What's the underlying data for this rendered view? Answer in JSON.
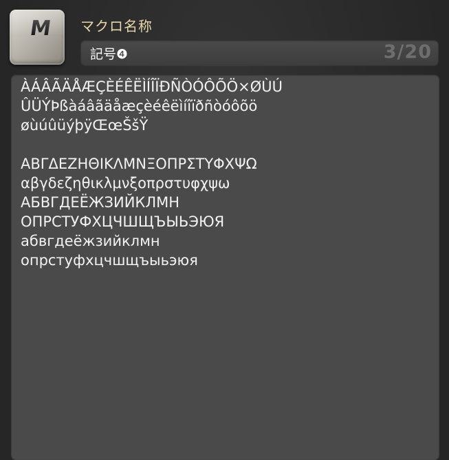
{
  "macro_icon": {
    "letter": "M"
  },
  "header": {
    "label": "マクロ名称",
    "name_value": "記号❹",
    "char_count": "3/20"
  },
  "body": {
    "lines": [
      "ÀÁÂÃÄÅÆÇÈÉÊËÌÍÎÏÐÑÒÓÔÕÖ×ØÙÚ",
      "ÛÜÝÞßàáâãäåæçèéêëìíîïðñòóôõö",
      "øùúûüýþÿŒœŠšŸ",
      "",
      "ΑΒΓΔΕΖΗΘΙΚΛΜΝΞΟΠΡΣΤΥΦΧΨΩ",
      "αβγδεζηθικλμνξοπρστυφχψω",
      "АБВГДЕЁЖЗИЙКЛМН",
      "ОПРСТУФХЦЧШЩЪЫЬЭЮЯ",
      "абвгдеёжзийклмн",
      "опрстуфхцчшщъыьэюя"
    ]
  }
}
